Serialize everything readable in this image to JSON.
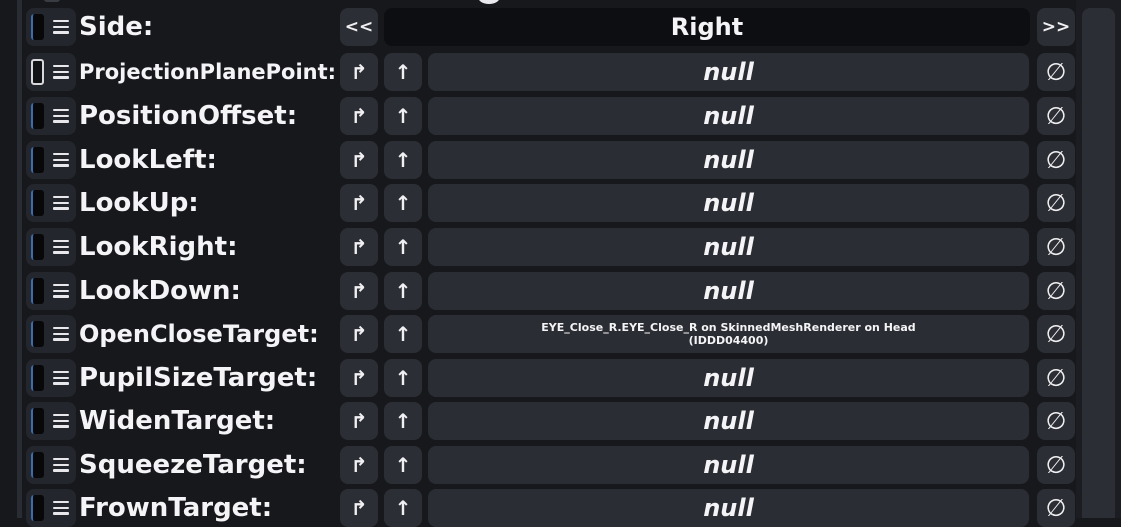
{
  "side_row": {
    "label": "Side:",
    "prev_label": "<<",
    "value": "Right",
    "next_label": ">>"
  },
  "icons": {
    "jump": "↱",
    "up": "↑",
    "clear": "∅"
  },
  "rows": [
    {
      "label": "ProjectionPlanePoint:",
      "value": "null",
      "is_null": true
    },
    {
      "label": "PositionOffset:",
      "value": "null",
      "is_null": true
    },
    {
      "label": "LookLeft:",
      "value": "null",
      "is_null": true
    },
    {
      "label": "LookUp:",
      "value": "null",
      "is_null": true
    },
    {
      "label": "LookRight:",
      "value": "null",
      "is_null": true
    },
    {
      "label": "LookDown:",
      "value": "null",
      "is_null": true
    },
    {
      "label": "OpenCloseTarget:",
      "value_line1": "EYE_Close_R.EYE_Close_R on SkinnedMeshRenderer on Head",
      "value_line2": "(IDDD04400)",
      "is_null": false
    },
    {
      "label": "PupilSizeTarget:",
      "value": "null",
      "is_null": true
    },
    {
      "label": "WidenTarget:",
      "value": "null",
      "is_null": true
    },
    {
      "label": "SqueezeTarget:",
      "value": "null",
      "is_null": true
    },
    {
      "label": "FrownTarget:",
      "value": "null",
      "is_null": true
    }
  ]
}
